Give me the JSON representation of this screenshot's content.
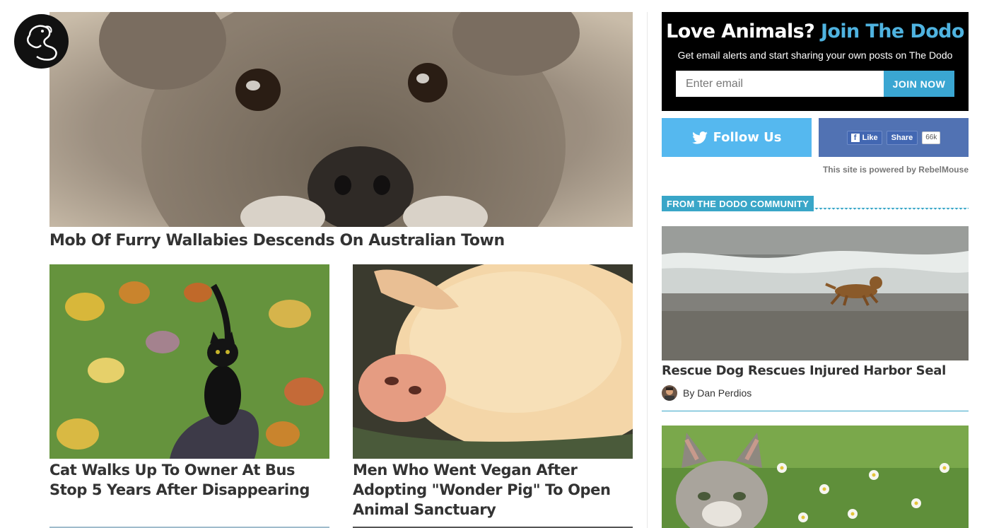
{
  "logo": {
    "icon": "dodo-bird-icon"
  },
  "hero": {
    "headline": "Mob Of Furry Wallabies Descends On Australian Town",
    "image": "wallaby-photo"
  },
  "cards": [
    {
      "headline": "Cat Walks Up To Owner At Bus Stop 5 Years After Disappearing",
      "image": "black-cat-photo"
    },
    {
      "headline": "Men Who Went Vegan After Adopting \"Wonder Pig\" To Open Animal Sanctuary",
      "image": "pig-photo"
    }
  ],
  "sidebar": {
    "join": {
      "title_prefix": "Love Animals? ",
      "title_accent": "Join The Dodo",
      "subtitle": "Get email alerts and start sharing your own posts on The Dodo",
      "email_placeholder": "Enter email",
      "button_label": "JOIN NOW"
    },
    "follow": {
      "label": "Follow Us",
      "icon": "twitter-bird-icon"
    },
    "facebook": {
      "like_label": "Like",
      "share_label": "Share",
      "count": "66k"
    },
    "powered_by": "This site is powered by RebelMouse",
    "community": {
      "section_title": "FROM THE DODO COMMUNITY",
      "posts": [
        {
          "title": "Rescue Dog Rescues Injured Harbor Seal",
          "by": "By Dan Perdios",
          "image": "dog-on-beach-photo"
        },
        {
          "image": "kitten-in-grass-photo"
        }
      ]
    }
  },
  "colors": {
    "accent": "#39a6c8",
    "twitter": "#55b8ef",
    "facebook": "#5172b3",
    "join_bg": "#000000"
  }
}
